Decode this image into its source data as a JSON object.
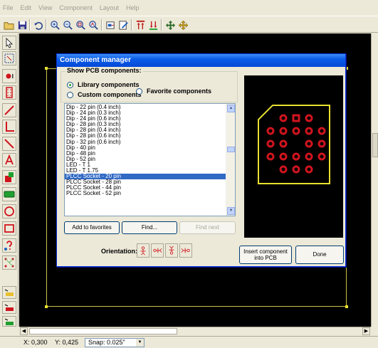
{
  "menu": [
    "File",
    "Edit",
    "View",
    "Component",
    "Layout",
    "Help"
  ],
  "toolbar_icons": [
    "open-folder-icon",
    "save-icon",
    "undo-icon",
    "zoom-in-icon",
    "zoom-out-icon",
    "zoom-window-icon",
    "zoom-fit-icon",
    "component-manager-icon",
    "properties-icon",
    "move-top-icon",
    "move-bottom-icon",
    "rotate-icon",
    "move-icon"
  ],
  "palette_icons": [
    "pointer-icon",
    "zoom-select-icon",
    "pad-icon",
    "component-icon",
    "line-icon",
    "corner-line-icon",
    "diagonal-line-icon",
    "text-icon",
    "layer-icon",
    "chip-icon",
    "circle-icon",
    "rectangle-icon",
    "query-icon",
    "net-icon",
    "layer-toggle-1-icon",
    "layer-toggle-2-icon",
    "layer-toggle-3-icon"
  ],
  "dialog": {
    "title": "Component manager",
    "group_title": "Show PCB components:",
    "radio_library": "Library components",
    "radio_custom": "Custom components",
    "radio_favorite": "Favorite components",
    "list_items": [
      "Dip - 22 pin  (0.4 inch)",
      "Dip - 24 pin  (0.3 inch)",
      "Dip - 24 pin  (0.6 inch)",
      "Dip - 28 pin  (0.3 inch)",
      "Dip - 28 pin  (0.4 inch)",
      "Dip - 28 pin  (0.6 inch)",
      "Dip - 32 pin  (0.6 inch)",
      "Dip - 40 pin",
      "Dip - 48 pin",
      "Dip - 52 pin",
      "LED - T 1",
      "LED - T 1.75",
      "PLCC Socket - 20 pin",
      "PLCC Socket - 28 pin",
      "PLCC Socket - 44 pin",
      "PLCC Socket - 52 pin"
    ],
    "selected_index": 12,
    "add_favorites": "Add to favorites",
    "find": "Find...",
    "find_next": "Find next",
    "orientation_label": "Orientation:",
    "insert_line1": "Insert component",
    "insert_line2": "into PCB",
    "done": "Done"
  },
  "status": {
    "x": "X: 0,300",
    "y": "Y: 0,425",
    "snap": "Snap: 0.025\""
  },
  "colors": {
    "pad": "#d0141e",
    "outline": "#e8e030",
    "title_bar": "#0a5ce8",
    "selection": "#316ac5"
  }
}
